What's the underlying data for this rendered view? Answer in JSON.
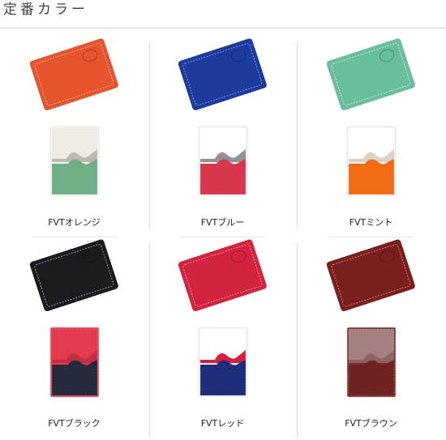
{
  "header": {
    "title": "定番カラー"
  },
  "products": [
    {
      "label": "FVTオレンジ",
      "cover": "#e5552d",
      "stitch": "#ffd9c8",
      "top_inner": "#efeae4",
      "top_edge": "#bfb8b0",
      "bottom_inner": "#6fae86",
      "frame": "#f4f4f4"
    },
    {
      "label": "FVTブルー",
      "cover": "#1d3b9c",
      "stitch": "#a9c0ff",
      "top_inner": "#ffffff",
      "top_edge": "#8e9396",
      "bottom_inner": "#d8364a",
      "frame": "#f4f4f4"
    },
    {
      "label": "FVTミント",
      "cover": "#69bf9c",
      "stitch": "#e9fff6",
      "top_inner": "#ffffff",
      "top_edge": "#d9d2c8",
      "bottom_inner": "#f06b13",
      "frame": "#f4f4f4"
    },
    {
      "label": "FVTブラック",
      "cover": "#1b1b1f",
      "stitch": "#c8c8d2",
      "top_inner": "#e23a4e",
      "top_edge": "#c62d40",
      "bottom_inner": "#262b3c",
      "frame": "#e23a4e"
    },
    {
      "label": "FVTレッド",
      "cover": "#d3243f",
      "stitch": "#ffc0cc",
      "top_inner": "#ffffff",
      "top_edge": "#d8203e",
      "bottom_inner": "#1d2d79",
      "frame": "#f4f4f4"
    },
    {
      "label": "FVTブラウン",
      "cover": "#7a1f1c",
      "stitch": "#e8b9a8",
      "top_inner": "#a58080",
      "top_edge": "#8c6262",
      "bottom_inner": "#6e2320",
      "frame": "#7a2a27"
    }
  ]
}
